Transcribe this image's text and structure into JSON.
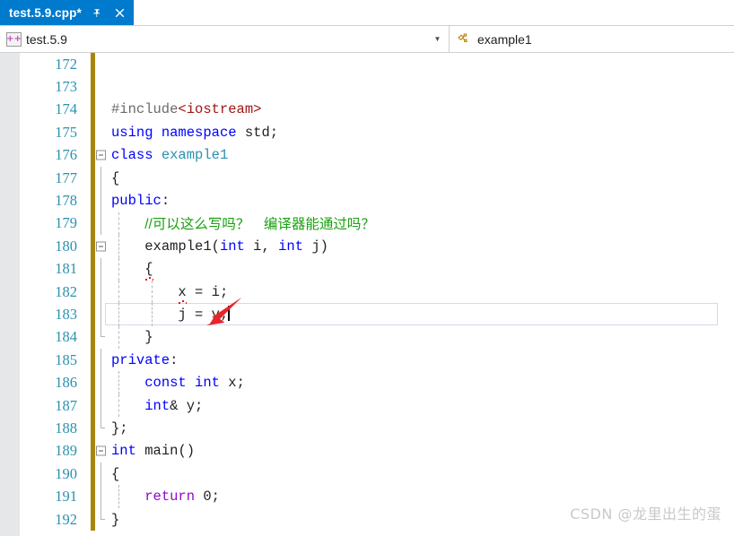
{
  "tab": {
    "title": "test.5.9.cpp*",
    "pin_icon": "pin-icon",
    "close_icon": "close-icon"
  },
  "navbar": {
    "left": {
      "icon": "cpp-file-icon",
      "icon_text": "++",
      "value": "test.5.9",
      "dropdown_icon": "chevron-down-icon"
    },
    "right": {
      "icon": "class-icon",
      "value": "example1"
    }
  },
  "editor": {
    "lines": [
      {
        "no": "172",
        "changed": true,
        "fold": "",
        "text": ""
      },
      {
        "no": "173",
        "changed": true,
        "fold": "",
        "text": ""
      },
      {
        "no": "174",
        "changed": true,
        "fold": "",
        "text": "#include<iostream>"
      },
      {
        "no": "175",
        "changed": true,
        "fold": "",
        "text": "using namespace std;"
      },
      {
        "no": "176",
        "changed": true,
        "fold": "minus",
        "text": "class example1"
      },
      {
        "no": "177",
        "changed": true,
        "fold": "line",
        "text": "{"
      },
      {
        "no": "178",
        "changed": true,
        "fold": "line",
        "text": "public:"
      },
      {
        "no": "179",
        "changed": true,
        "fold": "line",
        "text": "    //可以这么写吗？　编译器能通过吗？"
      },
      {
        "no": "180",
        "changed": true,
        "fold": "minus",
        "text": "    example1(int i, int j)"
      },
      {
        "no": "181",
        "changed": true,
        "fold": "line",
        "text": "    {"
      },
      {
        "no": "182",
        "changed": true,
        "fold": "line",
        "text": "        x = i;"
      },
      {
        "no": "183",
        "changed": true,
        "fold": "line",
        "text": "        j = y;",
        "current": true
      },
      {
        "no": "184",
        "changed": true,
        "fold": "endline",
        "text": "    }"
      },
      {
        "no": "185",
        "changed": true,
        "fold": "line",
        "text": "private:"
      },
      {
        "no": "186",
        "changed": true,
        "fold": "line",
        "text": "    const int x;"
      },
      {
        "no": "187",
        "changed": true,
        "fold": "line",
        "text": "    int& y;"
      },
      {
        "no": "188",
        "changed": true,
        "fold": "endline",
        "text": "};"
      },
      {
        "no": "189",
        "changed": true,
        "fold": "minus",
        "text": "int main()"
      },
      {
        "no": "190",
        "changed": true,
        "fold": "line",
        "text": "{"
      },
      {
        "no": "191",
        "changed": true,
        "fold": "line",
        "text": "    return 0;"
      },
      {
        "no": "192",
        "changed": true,
        "fold": "endline",
        "text": "}"
      }
    ],
    "comment_text": "//可以这么写吗？　编译器能通过吗？",
    "annotation": {
      "name": "red-arrow-annotation",
      "color": "#e8252a",
      "points_at": "x = i;"
    }
  },
  "watermark": {
    "text": "CSDN @龙里出生的蛋"
  },
  "colors": {
    "tab_active_bg": "#007acc",
    "line_number": "#2b91af",
    "change_bar": "#a8860b",
    "keyword": "#0000ff",
    "control_keyword": "#8f08c4",
    "type": "#2b91af",
    "comment": "#17a00e",
    "string": "#a31515",
    "preprocessor": "#6b6b6b",
    "selection_margin": "#e6e7e8"
  }
}
